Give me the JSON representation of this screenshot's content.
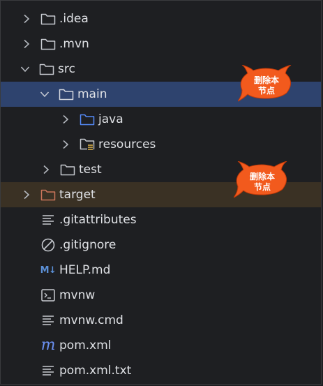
{
  "tree": {
    "rows": [
      {
        "label": ".idea",
        "icon": "folder-icon"
      },
      {
        "label": ".mvn",
        "icon": "folder-icon"
      },
      {
        "label": "src",
        "icon": "folder-icon"
      },
      {
        "label": "main",
        "icon": "folder-icon",
        "selected": true
      },
      {
        "label": "java",
        "icon": "source-folder-icon"
      },
      {
        "label": "resources",
        "icon": "resources-folder-icon"
      },
      {
        "label": "test",
        "icon": "folder-icon"
      },
      {
        "label": "target",
        "icon": "excluded-folder-icon"
      },
      {
        "label": ".gitattributes",
        "icon": "text-file-icon"
      },
      {
        "label": ".gitignore",
        "icon": "ignore-file-icon"
      },
      {
        "label": "HELP.md",
        "icon": "markdown-icon",
        "icon_text": "M↓"
      },
      {
        "label": "mvnw",
        "icon": "terminal-file-icon"
      },
      {
        "label": "mvnw.cmd",
        "icon": "text-file-icon"
      },
      {
        "label": "pom.xml",
        "icon": "maven-icon",
        "icon_text": "m"
      },
      {
        "label": "pom.xml.txt",
        "icon": "text-file-icon"
      }
    ]
  },
  "annotations": [
    {
      "line1": "删除本",
      "line2": "节点"
    },
    {
      "line1": "删除本",
      "line2": "节点"
    }
  ],
  "colors": {
    "background": "#1e1f22",
    "selected_row": "#2e436e",
    "excluded_row": "#3a3124",
    "badge_fill": "#f25a1d",
    "java_folder": "#548af7",
    "target_folder": "#c9745a"
  }
}
